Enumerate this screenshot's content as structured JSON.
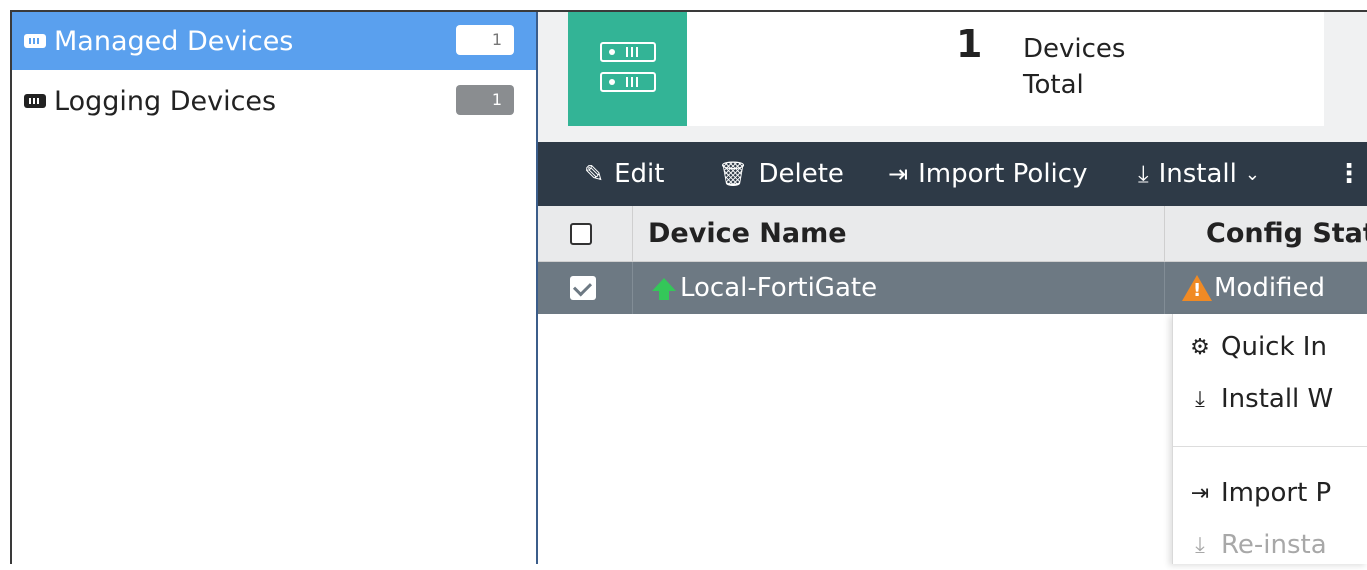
{
  "sidebar": {
    "items": [
      {
        "label": "Managed Devices",
        "count": "1",
        "icon": "device-icon",
        "active": true
      },
      {
        "label": "Logging Devices",
        "count": "1",
        "icon": "device-icon",
        "active": false
      }
    ]
  },
  "summary": {
    "icon": "server-icon",
    "count": "1",
    "label_line1": "Devices",
    "label_line2": "Total",
    "accent_color": "#33b496"
  },
  "toolbar": {
    "edit_label": "Edit",
    "delete_label": "Delete",
    "import_policy_label": "Import Policy",
    "install_label": "Install",
    "more_label": "⋮"
  },
  "table": {
    "columns": [
      "Device Name",
      "Config Stat"
    ],
    "rows": [
      {
        "selected": true,
        "device_name": "Local-FortiGate",
        "status_icon": "up-arrow-icon",
        "config_status": "Modified",
        "config_status_icon": "warning-icon"
      }
    ]
  },
  "install_menu": {
    "items": [
      {
        "label": "Quick In",
        "icon": "quick-install-icon",
        "enabled": true
      },
      {
        "label": "Install W",
        "icon": "install-icon",
        "enabled": true
      },
      {
        "label": "Import P",
        "icon": "import-icon",
        "enabled": true
      },
      {
        "label": "Re-insta",
        "icon": "reinstall-icon",
        "enabled": false
      }
    ]
  },
  "colors": {
    "sidebar_active": "#5aa0ee",
    "toolbar_bg": "#2e3a47",
    "selected_row": "#6d7983",
    "warning": "#f08a24",
    "online": "#34c759"
  }
}
